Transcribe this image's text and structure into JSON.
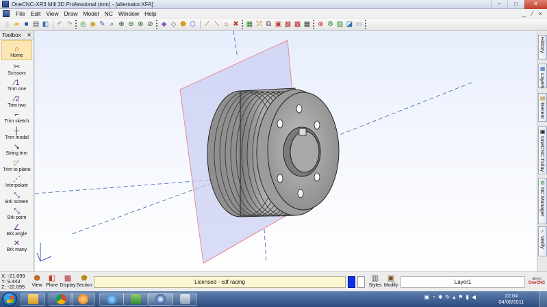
{
  "window": {
    "title": "OneCNC-XR3 Mill 3D Professional (mm) - [alternator.XFA]",
    "controls": [
      "–",
      "□",
      "✕"
    ]
  },
  "menu": {
    "items": [
      "File",
      "Edit",
      "View",
      "Draw",
      "Model",
      "NC",
      "Window",
      "Help"
    ],
    "right_controls": "_ ⁄ ×"
  },
  "toolbox": {
    "title": "Toolbox",
    "tools": [
      {
        "label": "Home",
        "icon": "home-icon"
      },
      {
        "label": "Scissors",
        "icon": "scissors-icon"
      },
      {
        "label": "Trim one",
        "icon": "trim-one-icon"
      },
      {
        "label": "Trim two",
        "icon": "trim-two-icon"
      },
      {
        "label": "Trim sketch",
        "icon": "trim-sketch-icon"
      },
      {
        "label": "Trim modal",
        "icon": "trim-modal-icon"
      },
      {
        "label": "String trim",
        "icon": "string-trim-icon"
      },
      {
        "label": "Trim to plane",
        "icon": "trim-to-plane-icon"
      },
      {
        "label": "Interpolate",
        "icon": "interpolate-icon"
      },
      {
        "label": "Brk screen",
        "icon": "break-screen-icon"
      },
      {
        "label": "Brk point",
        "icon": "break-point-icon"
      },
      {
        "label": "Brk angle",
        "icon": "break-angle-icon"
      },
      {
        "label": "Brk many",
        "icon": "break-many-icon"
      }
    ]
  },
  "right_tabs": [
    {
      "label": "History",
      "icon": "history-icon"
    },
    {
      "label": "Layers",
      "icon": "layers-icon"
    },
    {
      "label": "Recent",
      "icon": "recent-icon"
    },
    {
      "label": "OneCNC Today",
      "icon": "today-icon"
    },
    {
      "label": "NC Manager",
      "icon": "nc-manager-icon"
    },
    {
      "label": "Verify",
      "icon": "verify-icon"
    }
  ],
  "status": {
    "x": "X: -21.699",
    "y": "Y: 9.443",
    "z": "Z: -22.095",
    "buttons": [
      "View",
      "Plane",
      "Display",
      "Section"
    ],
    "license": "Licensed - cdf racing",
    "styles_label": "Styles",
    "modify_label": "Modify",
    "layer": "Layer1",
    "about_line1": "about",
    "about_line2": "OneCNC",
    "color_current": "#0d2ff2"
  },
  "taskbar": {
    "time": "22:04",
    "date": "04/08/2011"
  },
  "colors": {
    "plane_fill": "#c9cdf2",
    "plane_edge": "#e98a96",
    "part_gray": "#a6a6a6"
  }
}
